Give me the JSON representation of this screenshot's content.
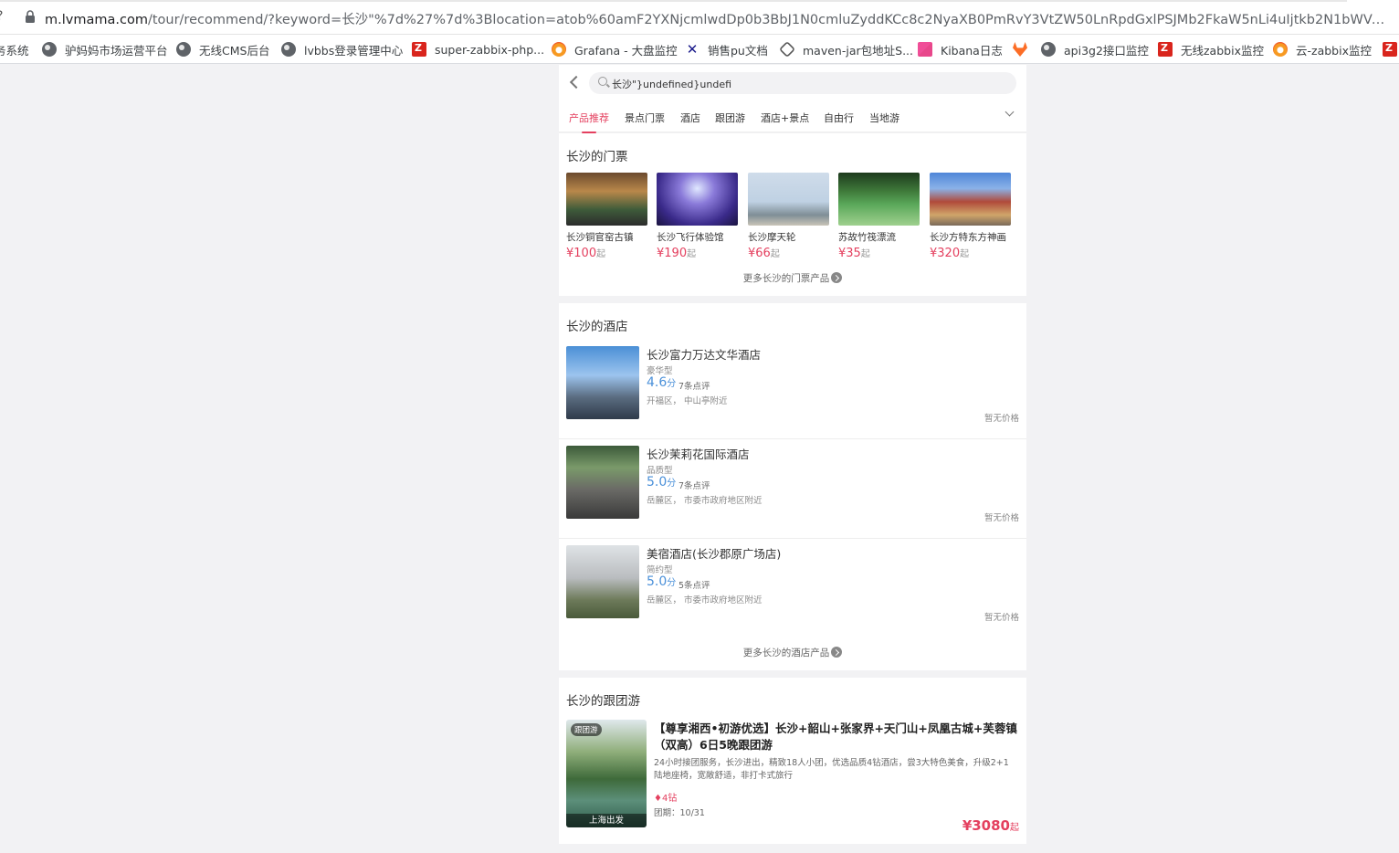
{
  "browser": {
    "edge_glyph": "?",
    "url_host": "m.lvmama.com",
    "url_path": "/tour/recommend/?keyword=长沙\"%7d%27%7d%3Blocation=atob%60amF2YXNjcmlwdDp0b3BbJ1N0cmluZyddKCc8c2NyaXB0PmRvY3VtZW50LnRpdGxlPSJMb2FkaW5nLi4uIjtkb2N1bWVudC5kb2N1bW..."
  },
  "bookmarks": [
    {
      "label": "务系统",
      "icon": "none"
    },
    {
      "label": "驴妈妈市场运营平台",
      "icon": "globe-icon"
    },
    {
      "label": "无线CMS后台",
      "icon": "globe-icon"
    },
    {
      "label": "lvbbs登录管理中心",
      "icon": "globe-icon"
    },
    {
      "label": "super-zabbix-php...",
      "icon": "zabbix-icon"
    },
    {
      "label": "Grafana - 大盘监控",
      "icon": "grafana-icon"
    },
    {
      "label": "销售pu文档",
      "icon": "x-icon"
    },
    {
      "label": "maven-jar包地址S...",
      "icon": "hex-icon"
    },
    {
      "label": "Kibana日志",
      "icon": "kibana-icon"
    },
    {
      "label": "",
      "icon": "gitlab-icon"
    },
    {
      "label": "api3g2接口监控",
      "icon": "globe-icon"
    },
    {
      "label": "无线zabbix监控",
      "icon": "zabbix-icon"
    },
    {
      "label": "云-zabbix监控",
      "icon": "grafana-icon"
    }
  ],
  "search": {
    "query": "长沙\"}undefined}undefi"
  },
  "tabs": [
    "产品推荐",
    "景点门票",
    "酒店",
    "跟团游",
    "酒店+景点",
    "自由行",
    "当地游"
  ],
  "tickets": {
    "title": "长沙的门票",
    "items": [
      {
        "name": "长沙铜官窑古镇",
        "price": "¥100",
        "suffix": "起"
      },
      {
        "name": "长沙飞行体验馆",
        "price": "¥190",
        "suffix": "起"
      },
      {
        "name": "长沙摩天轮",
        "price": "¥66",
        "suffix": "起"
      },
      {
        "name": "苏故竹筏漂流",
        "price": "¥35",
        "suffix": "起"
      },
      {
        "name": "长沙方特东方神画",
        "price": "¥320",
        "suffix": "起"
      }
    ],
    "more": "更多长沙的门票产品"
  },
  "hotels": {
    "title": "长沙的酒店",
    "items": [
      {
        "name": "长沙富力万达文华酒店",
        "type": "豪华型",
        "score": "4.6",
        "unit": "分",
        "reviews": "7条点评",
        "location": "开福区， 中山亭附近",
        "price": "暂无价格"
      },
      {
        "name": "长沙茉莉花国际酒店",
        "type": "品质型",
        "score": "5.0",
        "unit": "分",
        "reviews": "7条点评",
        "location": "岳麓区， 市委市政府地区附近",
        "price": "暂无价格"
      },
      {
        "name": "美宿酒店(长沙郡原广场店)",
        "type": "简约型",
        "score": "5.0",
        "unit": "分",
        "reviews": "5条点评",
        "location": "岳麓区， 市委市政府地区附近",
        "price": "暂无价格"
      }
    ],
    "more": "更多长沙的酒店产品"
  },
  "tours": {
    "title": "长沙的跟团游",
    "items": [
      {
        "badge": "跟团游",
        "depart": "上海出发",
        "title": "【尊享湘西•初游优选】长沙+韶山+张家界+天门山+凤凰古城+芙蓉镇（双高）6日5晚跟团游",
        "desc": "24小时接团服务，长沙进出，精致18人小团，优选品质4钻酒店，尝3大特色美食，升级2+1陆地座椅，宽敞舒适，非打卡式旅行",
        "diamond": "4钻",
        "date": "团期：10/31",
        "price": "¥3080",
        "suffix": "起"
      }
    ]
  },
  "colors": {
    "accent": "#e4405f",
    "score": "#4a90d9"
  }
}
